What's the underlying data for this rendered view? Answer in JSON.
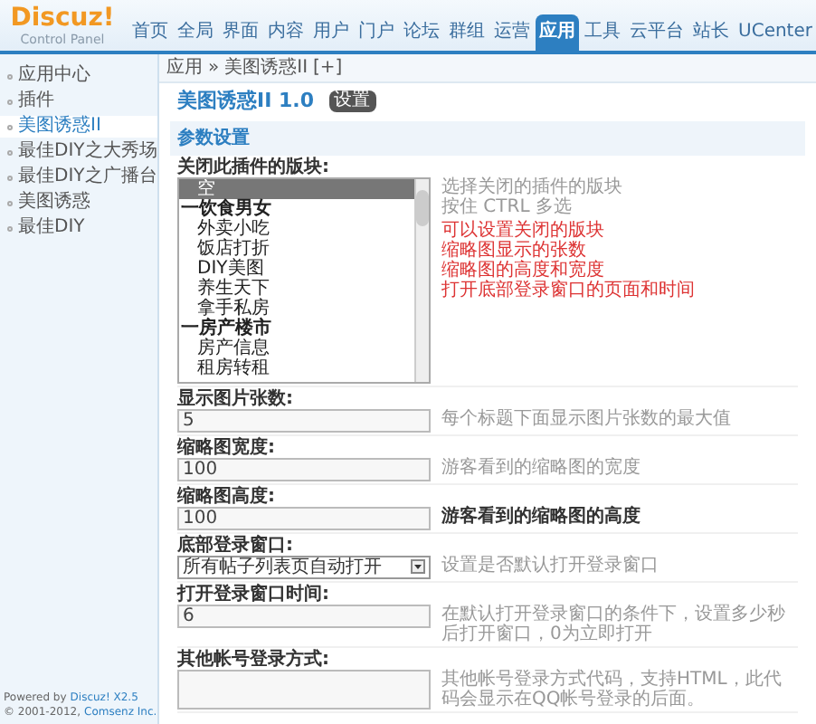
{
  "logo": {
    "name": "Discuz!",
    "subtitle": "Control Panel"
  },
  "nav": [
    {
      "label": "首页",
      "selected": false
    },
    {
      "label": "全局",
      "selected": false
    },
    {
      "label": "界面",
      "selected": false
    },
    {
      "label": "内容",
      "selected": false
    },
    {
      "label": "用户",
      "selected": false
    },
    {
      "label": "门户",
      "selected": false
    },
    {
      "label": "论坛",
      "selected": false
    },
    {
      "label": "群组",
      "selected": false
    },
    {
      "label": "运营",
      "selected": false
    },
    {
      "label": "应用",
      "selected": true
    },
    {
      "label": "工具",
      "selected": false
    },
    {
      "label": "云平台",
      "selected": false
    },
    {
      "label": "站长",
      "selected": false
    },
    {
      "label": "UCenter",
      "selected": false
    }
  ],
  "breadcrumb": {
    "items": [
      "应用",
      "美图诱惑II"
    ],
    "separator": "»",
    "toggle": "[+]"
  },
  "sidebar": {
    "items": [
      {
        "label": "应用中心",
        "selected": false
      },
      {
        "label": "插件",
        "selected": false
      },
      {
        "label": "美图诱惑II",
        "selected": true
      },
      {
        "label": "最佳DIY之大秀场",
        "selected": false
      },
      {
        "label": "最佳DIY之广播台",
        "selected": false
      },
      {
        "label": "美图诱惑",
        "selected": false
      },
      {
        "label": "最佳DIY",
        "selected": false
      }
    ],
    "footer": {
      "powered": "Powered by",
      "product": "Discuz! X2.5",
      "copyright": "© 2001-2012,",
      "company": "Comsenz Inc."
    }
  },
  "page": {
    "title": "美图诱惑II 1.0",
    "tab": "设置",
    "section": "参数设置"
  },
  "settings": [
    {
      "kind": "listbox",
      "label": "关闭此插件的版块:",
      "options": [
        {
          "label": "空",
          "selected": true,
          "group": false
        },
        {
          "label": "一饮食男女",
          "selected": false,
          "group": true
        },
        {
          "label": "外卖小吃",
          "selected": false,
          "group": false
        },
        {
          "label": "饭店打折",
          "selected": false,
          "group": false
        },
        {
          "label": "DIY美图",
          "selected": false,
          "group": false
        },
        {
          "label": "养生天下",
          "selected": false,
          "group": false
        },
        {
          "label": "拿手私房",
          "selected": false,
          "group": false
        },
        {
          "label": "一房产楼市",
          "selected": false,
          "group": true
        },
        {
          "label": "房产信息",
          "selected": false,
          "group": false
        },
        {
          "label": "租房转租",
          "selected": false,
          "group": false
        }
      ],
      "hints": [
        "选择关闭的插件的版块",
        "按住 CTRL 多选"
      ],
      "notes": [
        "可以设置关闭的版块",
        "缩略图显示的张数",
        "缩略图的高度和宽度",
        "打开底部登录窗口的页面和时间"
      ]
    },
    {
      "kind": "text",
      "label": "显示图片张数:",
      "value": "5",
      "hints": [
        "每个标题下面显示图片张数的最大值"
      ]
    },
    {
      "kind": "text",
      "label": "缩略图宽度:",
      "value": "100",
      "hints": [
        "游客看到的缩略图的宽度"
      ]
    },
    {
      "kind": "text",
      "label": "缩略图高度:",
      "value": "100",
      "hints": [
        "游客看到的缩略图的高度"
      ],
      "hint_bold": true
    },
    {
      "kind": "select",
      "label": "底部登录窗口:",
      "value": "所有帖子列表页自动打开",
      "hints": [
        "设置是否默认打开登录窗口"
      ]
    },
    {
      "kind": "text",
      "label": "打开登录窗口时间:",
      "value": "6",
      "hints": [
        "在默认打开登录窗口的条件下，设置多少秒后打开窗口，0为立即打开"
      ]
    },
    {
      "kind": "textarea",
      "label": "其他帐号登录方式:",
      "hints": [
        "其他帐号登录方式代码，支持HTML，此代码会显示在QQ帐号登录的后面。"
      ]
    }
  ]
}
